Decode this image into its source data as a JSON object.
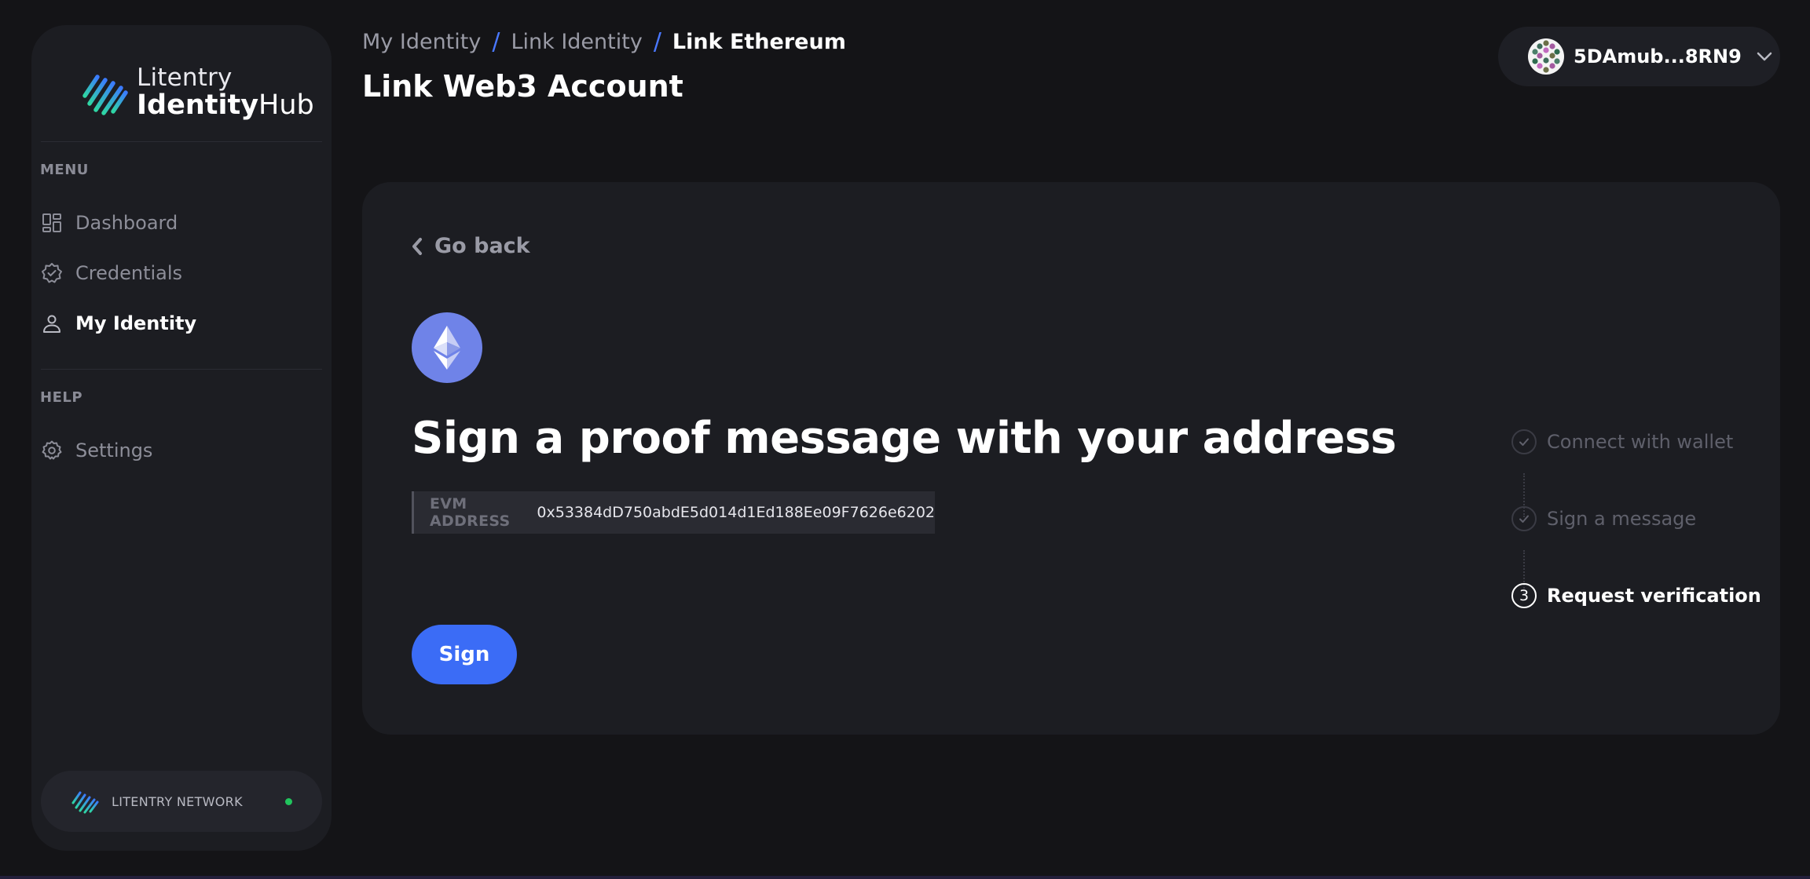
{
  "sidebar": {
    "logo_top": "Litentry",
    "logo_bottom_bold": "Identity",
    "logo_bottom_light": "Hub",
    "menu_heading": "MENU",
    "help_heading": "HELP",
    "items": [
      {
        "label": "Dashboard",
        "icon": "dashboard-icon"
      },
      {
        "label": "Credentials",
        "icon": "credentials-badge-icon"
      },
      {
        "label": "My Identity",
        "icon": "user-icon",
        "active": true
      },
      {
        "label": "Settings",
        "icon": "gear-icon"
      }
    ],
    "network_label": "LITENTRY NETWORK",
    "network_status_color": "#21c55d"
  },
  "header": {
    "breadcrumb": [
      "My Identity",
      "Link Identity",
      "Link Ethereum"
    ],
    "separator": "/",
    "title": "Link Web3 Account",
    "account_name": "5DAmub...8RN9"
  },
  "main": {
    "go_back": "Go back",
    "headline": "Sign a proof message with your address",
    "address_label": "EVM ADDRESS",
    "address_value": "0x53384dD750abdE5d014d1Ed188Ee09F7626e6202",
    "sign_button": "Sign",
    "steps": [
      {
        "label": "Connect with wallet",
        "state": "done"
      },
      {
        "label": "Sign a message",
        "state": "done"
      },
      {
        "number": "3",
        "label": "Request verification",
        "state": "current"
      }
    ]
  },
  "colors": {
    "accent": "#3b6cf6",
    "breadcrumb_separator": "#4a78ff",
    "ethereum_badge": "#6f83e8"
  }
}
